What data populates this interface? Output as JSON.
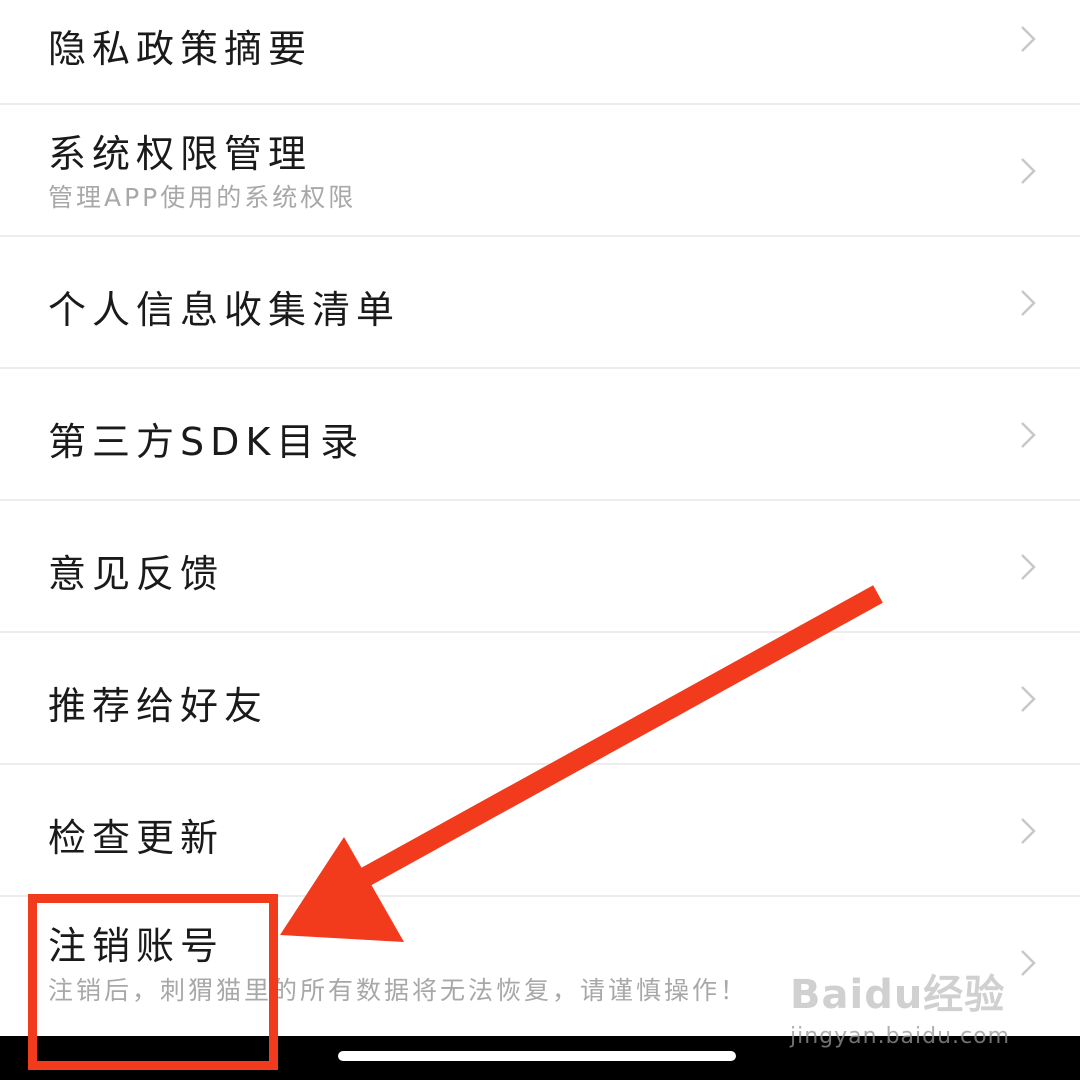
{
  "menu": {
    "items": [
      {
        "title": "隐私政策摘要",
        "subtitle": ""
      },
      {
        "title": "系统权限管理",
        "subtitle": "管理APP使用的系统权限"
      },
      {
        "title": "个人信息收集清单",
        "subtitle": ""
      },
      {
        "title": "第三方SDK目录",
        "subtitle": ""
      },
      {
        "title": "意见反馈",
        "subtitle": ""
      },
      {
        "title": "推荐给好友",
        "subtitle": ""
      },
      {
        "title": "检查更新",
        "subtitle": ""
      },
      {
        "title": "注销账号",
        "subtitle": "注销后，刺猬猫里的所有数据将无法恢复，请谨慎操作！"
      }
    ]
  },
  "annotation": {
    "color": "#f23a1c"
  },
  "watermark": {
    "logo": "Baidu经验",
    "url": "jingyan.baidu.com"
  },
  "icons": {
    "row_chevron": "chevron-right-icon"
  }
}
